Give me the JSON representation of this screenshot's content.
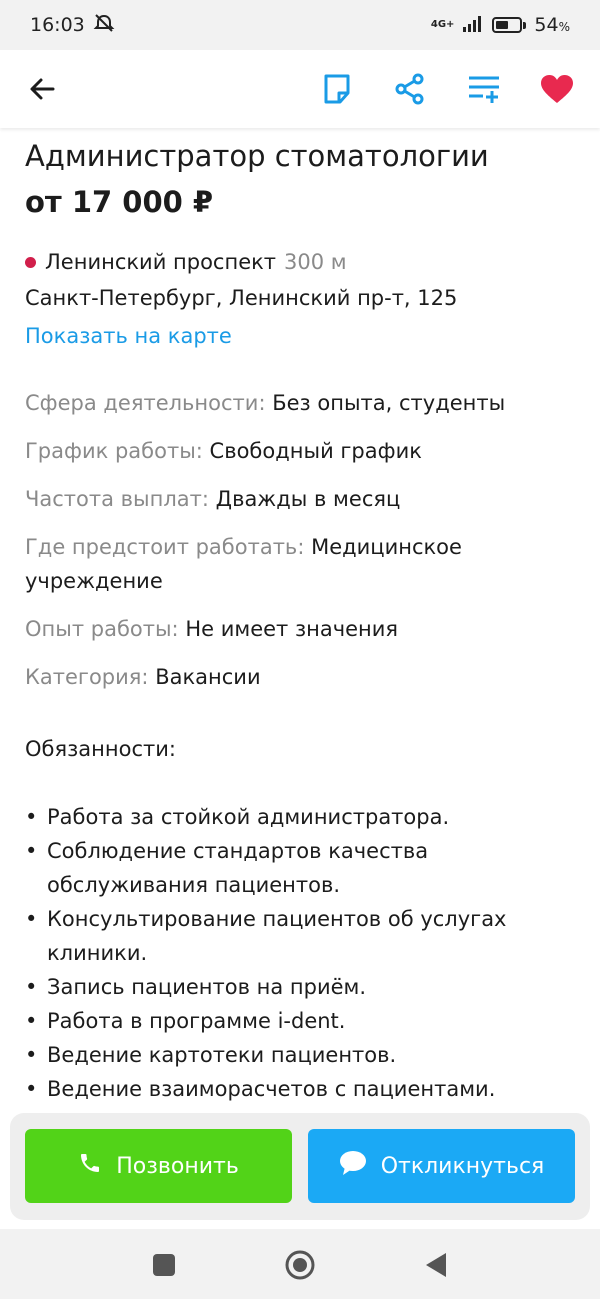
{
  "status_bar": {
    "time": "16:03",
    "network": "4G+",
    "battery_percent": "54",
    "battery_unit": "%",
    "battery_level": 0.54
  },
  "toolbar": {
    "icons": [
      "back-arrow-icon",
      "note-icon",
      "share-icon",
      "filter-add-icon",
      "heart-icon"
    ],
    "accent_color": "#1a9be6",
    "favorite_color": "#e8294f"
  },
  "vacancy": {
    "title": "Администратор стоматологии",
    "salary": "от 17 000 ₽",
    "metro": {
      "station": "Ленинский проспект",
      "distance": "300 м",
      "dot_color": "#d11f4b"
    },
    "address": "Санкт-Петербург, Ленинский пр-т, 125",
    "map_link": "Показать на карте",
    "attributes": [
      {
        "label": "Сфера деятельности:",
        "value": "Без опыта, студенты"
      },
      {
        "label": "График работы:",
        "value": "Свободный график"
      },
      {
        "label": "Частота выплат:",
        "value": "Дважды в месяц"
      },
      {
        "label": "Где предстоит работать:",
        "value": "Медицинское учреждение"
      },
      {
        "label": "Опыт работы:",
        "value": "Не имеет значения"
      },
      {
        "label": "Категория:",
        "value": "Вакансии"
      }
    ],
    "duties_heading": "Обязанности:",
    "duties": [
      "Работа за стойкой администратора.",
      "Соблюдение стандартов качества обслуживания пациентов.",
      "Консультирование пациентов об услугах клиники.",
      "Запись пациентов на приём.",
      "Работа в программе i-dent.",
      "Ведение картотеки пациентов.",
      "Ведение взаиморасчетов с пациентами."
    ]
  },
  "actions": {
    "call_label": "Позвонить",
    "respond_label": "Откликнуться",
    "call_color": "#52d318",
    "respond_color": "#1ba9f5"
  },
  "nav_bar": {
    "icons": [
      "recent-apps-icon",
      "home-icon",
      "back-icon"
    ]
  }
}
